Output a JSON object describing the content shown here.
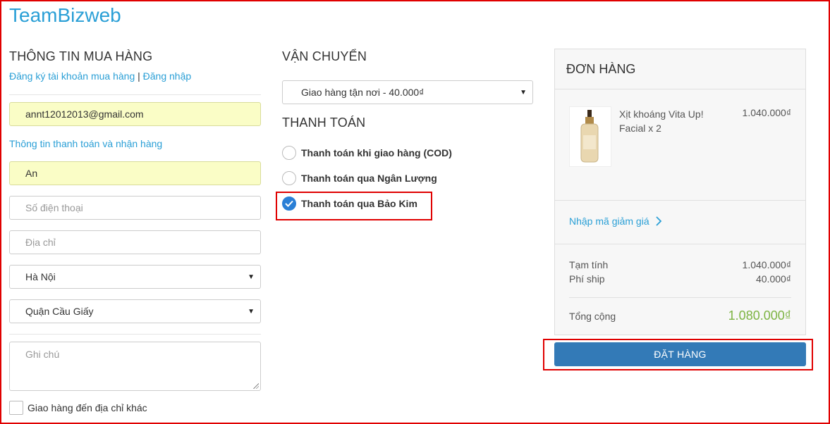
{
  "brand": {
    "name": "TeamBizweb"
  },
  "buyer": {
    "title": "THÔNG TIN MUA HÀNG",
    "register_link": "Đăng ký tài khoản mua hàng",
    "separator": "|",
    "login_link": "Đăng nhập",
    "email_value": "annt12012013@gmail.com",
    "billing_link": "Thông tin thanh toán và nhận hàng",
    "name_value": "An",
    "phone_placeholder": "Số điện thoại",
    "address_placeholder": "Địa chỉ",
    "city_selected": "Hà Nội",
    "district_selected": "Quận Cầu Giấy",
    "note_placeholder": "Ghi chú",
    "ship_other_label": "Giao hàng đến địa chỉ khác"
  },
  "shipping": {
    "title": "VẬN CHUYỂN",
    "selected": "Giao hàng tận nơi - 40.000₫"
  },
  "payment": {
    "title": "THANH TOÁN",
    "options": [
      {
        "label": "Thanh toán khi giao hàng (COD)",
        "checked": false
      },
      {
        "label": "Thanh toán qua Ngân Lượng",
        "checked": false
      },
      {
        "label": "Thanh toán qua Bảo Kim",
        "checked": true
      }
    ]
  },
  "order": {
    "title": "ĐƠN HÀNG",
    "item": {
      "name": "Xịt khoáng Vita Up! Facial x 2",
      "price": "1.040.000₫"
    },
    "coupon_link": "Nhập mã giảm giá",
    "subtotal_label": "Tạm tính",
    "subtotal_value": "1.040.000₫",
    "shipping_label": "Phí ship",
    "shipping_value": "40.000₫",
    "total_label": "Tổng cộng",
    "total_value": "1.080.000₫",
    "submit_label": "ĐẶT HÀNG"
  },
  "colors": {
    "link": "#2a9fd6",
    "highlight": "#e00000",
    "button": "#337ab7",
    "total": "#7cb342",
    "autofill": "#fafdc6"
  },
  "icons": [
    "dropdown-caret-icon",
    "radio-check-icon",
    "chevron-right-icon",
    "resize-handle-icon"
  ]
}
